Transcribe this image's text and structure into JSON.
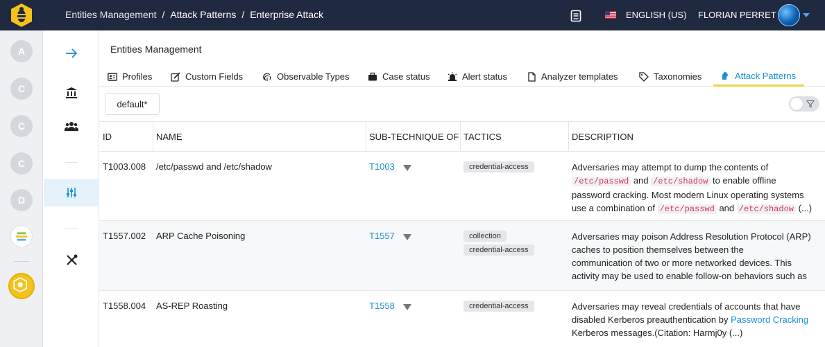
{
  "colors": {
    "topbar": "#1f2940",
    "accent": "#1c8fd6",
    "tab_underline": "#f0d248",
    "tag_bg": "#e4e6e9",
    "code": "#d6336c"
  },
  "header": {
    "breadcrumb": [
      "Entities Management",
      "Attack Patterns",
      "Enterprise Attack"
    ],
    "language": "ENGLISH (US)",
    "user": "FLORIAN PERRET",
    "icons": [
      "hive-logo-icon",
      "book-icon",
      "us-flag-icon",
      "user-avatar",
      "chevron-down-icon"
    ]
  },
  "rail": {
    "orgs": [
      "A",
      "C",
      "C",
      "C",
      "D"
    ]
  },
  "page": {
    "title": "Entities Management"
  },
  "tabs": [
    {
      "label": "Profiles",
      "icon": "id-card-icon"
    },
    {
      "label": "Custom Fields",
      "icon": "edit-icon"
    },
    {
      "label": "Observable Types",
      "icon": "fingerprint-icon"
    },
    {
      "label": "Case status",
      "icon": "briefcase-icon"
    },
    {
      "label": "Alert status",
      "icon": "siren-icon"
    },
    {
      "label": "Analyzer templates",
      "icon": "file-icon"
    },
    {
      "label": "Taxonomies",
      "icon": "tag-icon"
    },
    {
      "label": "Attack Patterns",
      "icon": "attack-icon",
      "active": true
    }
  ],
  "filter": {
    "label": "default*"
  },
  "table": {
    "headers": [
      "ID",
      "NAME",
      "SUB-TECHNIQUE OF",
      "TACTICS",
      "DESCRIPTION"
    ],
    "rows": [
      {
        "id": "T1003.008",
        "name": "/etc/passwd and /etc/shadow",
        "parent": "T1003",
        "tactics": [
          "credential-access"
        ],
        "desc": [
          "Adversaries may attempt to dump the contents of",
          "/etc/passwd",
          "and",
          "/etc/shadow",
          "to enable offline",
          "password cracking. Most modern Linux operating systems",
          "use a combination of",
          "/etc/passwd",
          "and",
          "/etc/shadow",
          "(...)"
        ]
      },
      {
        "id": "T1557.002",
        "name": "ARP Cache Poisoning",
        "parent": "T1557",
        "tactics": [
          "collection",
          "credential-access"
        ],
        "desc": [
          "Adversaries may poison Address Resolution Protocol (ARP)",
          "caches to position themselves between the",
          "communication of two or more networked devices. This",
          "activity may be used to enable follow-on behaviors such as"
        ]
      },
      {
        "id": "T1558.004",
        "name": "AS-REP Roasting",
        "parent": "T1558",
        "tactics": [
          "credential-access"
        ],
        "desc": [
          "Adversaries may reveal credentials of accounts that have",
          "disabled Kerberos preauthentication by",
          "Password Cracking",
          "Kerberos messages.(Citation: Harmj0y (...)"
        ]
      }
    ]
  }
}
